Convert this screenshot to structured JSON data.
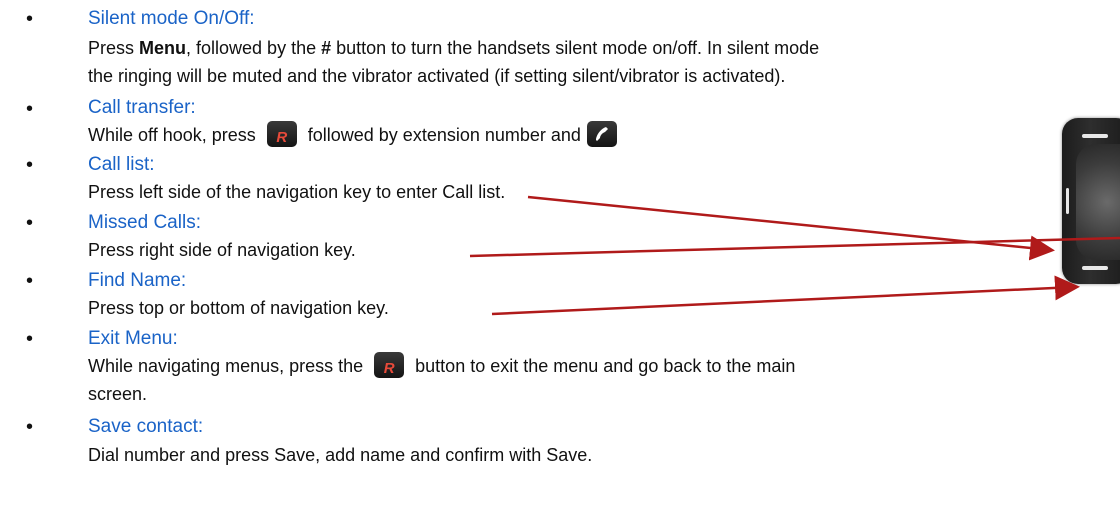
{
  "items": [
    {
      "bullet": "•",
      "title": "Silent mode On/Off:",
      "desc_pre": "Press ",
      "desc_bold1": "Menu",
      "desc_mid": ", followed by the ",
      "desc_bold2": "#",
      "desc_post": " button to turn the handsets silent mode on/off. In silent mode",
      "desc_line2": "the ringing will be muted and the vibrator activated (if setting silent/vibrator is activated)."
    },
    {
      "bullet": "•",
      "title": "Call transfer:",
      "desc_pre": "While off hook, press ",
      "desc_post": " followed by extension number and"
    },
    {
      "bullet": "•",
      "title": "Call list:",
      "desc": "Press left side of the navigation key to enter Call list."
    },
    {
      "bullet": "•",
      "title": "Missed Calls:",
      "desc": "Press right side of navigation key."
    },
    {
      "bullet": "•",
      "title": "Find Name:",
      "desc": "Press top or bottom of navigation key."
    },
    {
      "bullet": "•",
      "title": "Exit Menu:",
      "desc_pre": "While navigating menus, press the ",
      "desc_post": " button to exit the menu and go back to the main",
      "desc_line2": "screen."
    },
    {
      "bullet": "•",
      "title": "Save contact:",
      "desc": "Dial number and press Save, add name and confirm with Save."
    }
  ],
  "keys": {
    "r_key_label": "R",
    "r_key_icon": "r-key-icon",
    "call_icon": "handset-call-icon"
  },
  "colors": {
    "title": "#1a63c7",
    "arrow": "#b01a1a",
    "key_glyph": "#e84a3a"
  }
}
